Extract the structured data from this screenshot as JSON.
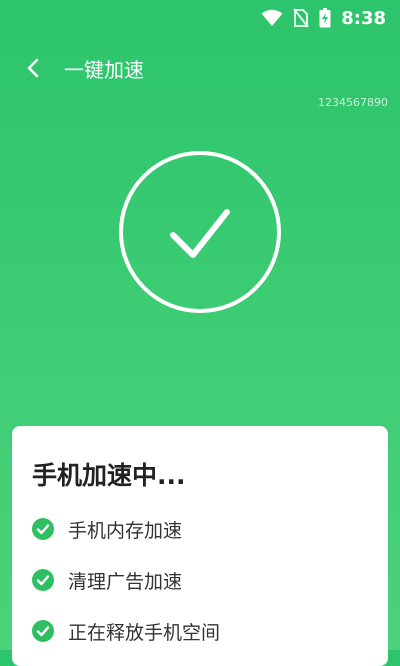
{
  "status_bar": {
    "time": "8:38",
    "icons": [
      "wifi-icon",
      "no-sim-icon",
      "battery-charging-icon"
    ]
  },
  "header": {
    "title": "一键加速",
    "back_icon": "back-arrow-icon"
  },
  "device_id": "1234567890",
  "status_icon": "check-circle-icon",
  "card": {
    "title": "手机加速中...",
    "items": [
      {
        "label": "手机内存加速",
        "icon": "check-badge-icon"
      },
      {
        "label": "清理广告加速",
        "icon": "check-badge-icon"
      },
      {
        "label": "正在释放手机空间",
        "icon": "check-badge-icon"
      }
    ]
  },
  "colors": {
    "accent_green": "#2cc46c",
    "check_green": "#2fbf63",
    "white": "#ffffff"
  }
}
